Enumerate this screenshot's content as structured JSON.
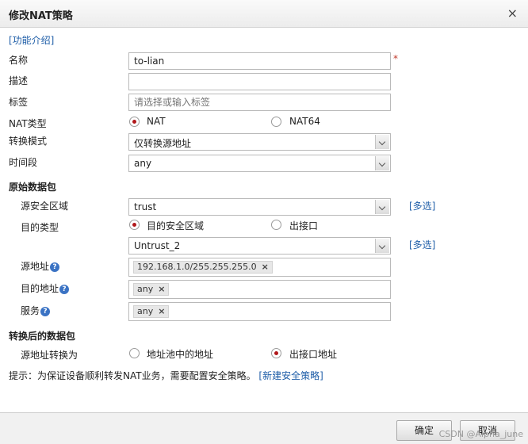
{
  "dialog": {
    "title": "修改NAT策略"
  },
  "intro_link": "[功能介绍]",
  "fields": {
    "name_label": "名称",
    "name_value": "to-lian",
    "required_mark": "*",
    "desc_label": "描述",
    "desc_value": "",
    "tag_label": "标签",
    "tag_placeholder": "请选择或输入标签",
    "nat_type_label": "NAT类型",
    "nat_type_options": [
      "NAT",
      "NAT64"
    ],
    "nat_type_selected": "NAT",
    "mode_label": "转换模式",
    "mode_value": "仅转换源地址",
    "time_label": "时间段",
    "time_value": "any"
  },
  "original_packet": {
    "section_title": "原始数据包",
    "src_zone_label": "源安全区域",
    "src_zone_value": "trust",
    "multi_select": "[多选]",
    "dest_type_label": "目的类型",
    "dest_type_options": [
      "目的安全区域",
      "出接口"
    ],
    "dest_type_selected": "目的安全区域",
    "dest_zone_value": "Untrust_2",
    "src_addr_label": "源地址",
    "src_addr_tag": "192.168.1.0/255.255.255.0",
    "dest_addr_label": "目的地址",
    "dest_addr_tag": "any",
    "service_label": "服务",
    "service_tag": "any",
    "help_glyph": "?",
    "remove_glyph": "×"
  },
  "translated_packet": {
    "section_title": "转换后的数据包",
    "src_translate_label": "源地址转换为",
    "options": [
      "地址池中的地址",
      "出接口地址"
    ],
    "selected": "出接口地址"
  },
  "hint": {
    "text": "提示：为保证设备顺利转发NAT业务，需要配置安全策略。",
    "link": "[新建安全策略]"
  },
  "footer": {
    "ok_label": "确定",
    "cancel_label": "取消",
    "watermark": "CSDN @Alpha_june"
  },
  "icons": {
    "close": "×"
  },
  "colors": {
    "link": "#1f5ea8",
    "required": "#c0392b",
    "radio_selected": "#b1181b",
    "help_icon": "#3b73c4"
  }
}
